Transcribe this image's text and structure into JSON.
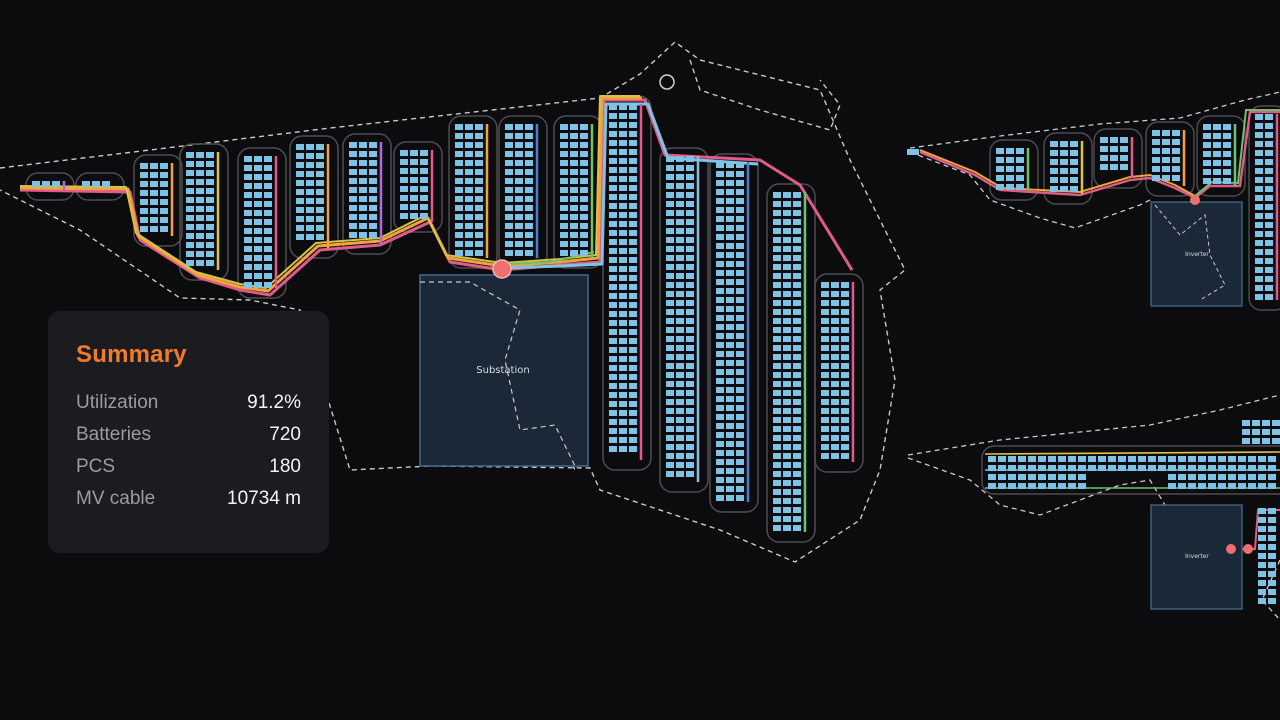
{
  "summary": {
    "title": "Summary",
    "rows": [
      {
        "label": "Utilization",
        "value": "91.2%"
      },
      {
        "label": "Batteries",
        "value": "720"
      },
      {
        "label": "PCS",
        "value": "180"
      },
      {
        "label": "MV cable",
        "value": "10734 m"
      }
    ]
  },
  "site_labels": {
    "main_substation": "Substation",
    "inverter_top": "Inverter",
    "inverter_bottom": "Inverter"
  },
  "colors": {
    "background": "#0c0c0e",
    "battery": "#7ec3e6",
    "substation_fill": "#1a2838",
    "substation_border": "#3f6b8e",
    "connection_point": "#ee6f6f",
    "accent": "#f07b2c"
  }
}
